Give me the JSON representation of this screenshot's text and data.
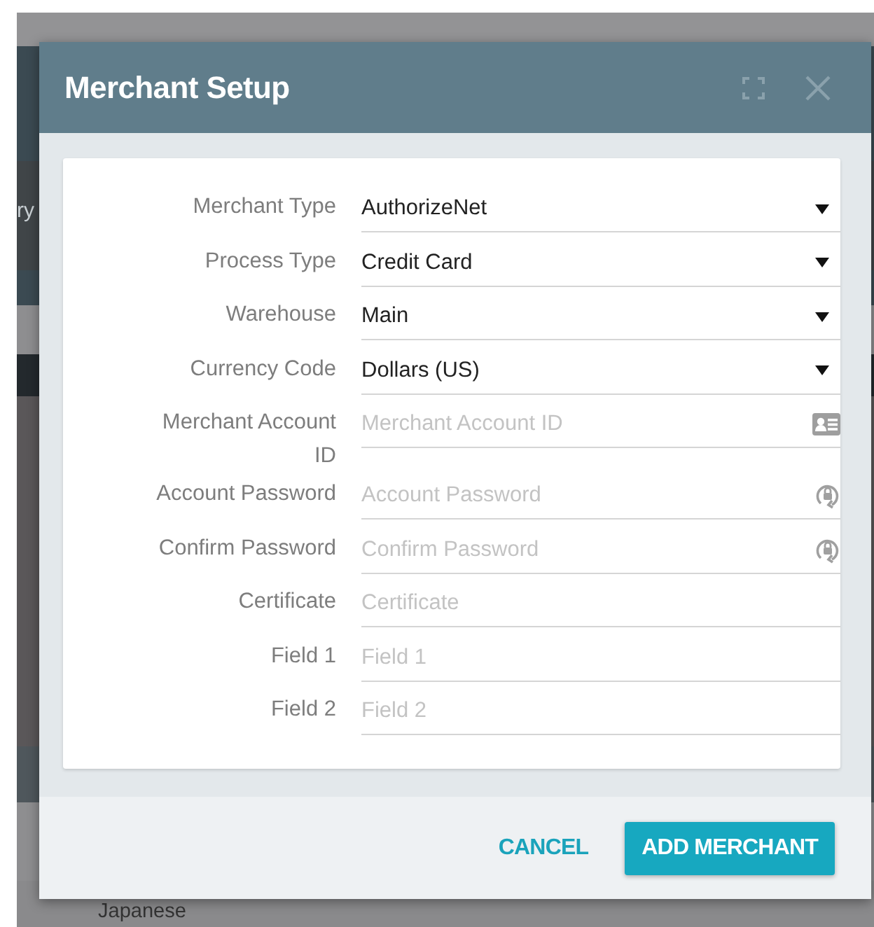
{
  "background": {
    "left_texts": [
      "ry"
    ],
    "bottom_text": "Japanese"
  },
  "dialog": {
    "title": "Merchant Setup",
    "fields": [
      {
        "kind": "select",
        "label": "Merchant Type",
        "value": "AuthorizeNet"
      },
      {
        "kind": "select",
        "label": "Process Type",
        "value": "Credit Card"
      },
      {
        "kind": "select",
        "label": "Warehouse",
        "value": "Main"
      },
      {
        "kind": "select",
        "label": "Currency Code",
        "value": "Dollars (US)"
      },
      {
        "kind": "id",
        "label": "Merchant Account ID",
        "placeholder": "Merchant Account ID"
      },
      {
        "kind": "password",
        "label": "Account Password",
        "placeholder": "Account Password"
      },
      {
        "kind": "password",
        "label": "Confirm Password",
        "placeholder": "Confirm Password"
      },
      {
        "kind": "text",
        "label": "Certificate",
        "placeholder": "Certificate"
      },
      {
        "kind": "text",
        "label": "Field 1",
        "placeholder": "Field 1"
      },
      {
        "kind": "text",
        "label": "Field 2",
        "placeholder": "Field 2"
      }
    ],
    "buttons": [
      {
        "kind": "flat",
        "label": "CANCEL"
      },
      {
        "kind": "raised",
        "label": "ADD MERCHANT"
      }
    ]
  }
}
